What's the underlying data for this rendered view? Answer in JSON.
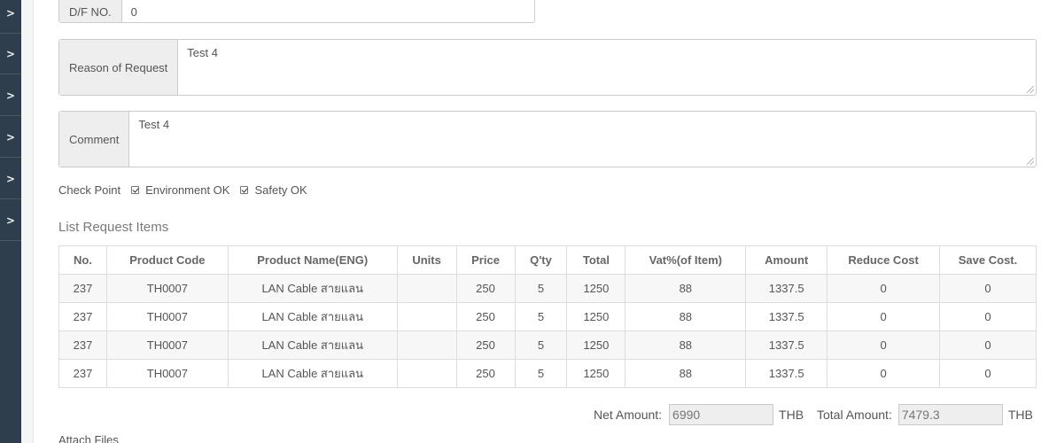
{
  "sidebar": {
    "items": [
      ">",
      ">",
      ">",
      ">",
      ">",
      ">"
    ]
  },
  "form": {
    "df_no": {
      "label": "D/F NO.",
      "value": "0"
    },
    "reason": {
      "label": "Reason of Request",
      "value": "Test 4"
    },
    "comment": {
      "label": "Comment",
      "value": "Test 4"
    },
    "checkpoint": {
      "label": "Check Point",
      "options": [
        {
          "label": "Environment OK",
          "checked": true
        },
        {
          "label": "Safety OK",
          "checked": true
        }
      ]
    }
  },
  "list": {
    "title": "List Request Items",
    "columns": [
      "No.",
      "Product Code",
      "Product Name(ENG)",
      "Units",
      "Price",
      "Q'ty",
      "Total",
      "Vat%(of Item)",
      "Amount",
      "Reduce Cost",
      "Save Cost."
    ],
    "rows": [
      [
        "237",
        "TH0007",
        "LAN Cable สายแลน",
        "",
        "250",
        "5",
        "1250",
        "88",
        "1337.5",
        "0",
        "0"
      ],
      [
        "237",
        "TH0007",
        "LAN Cable สายแลน",
        "",
        "250",
        "5",
        "1250",
        "88",
        "1337.5",
        "0",
        "0"
      ],
      [
        "237",
        "TH0007",
        "LAN Cable สายแลน",
        "",
        "250",
        "5",
        "1250",
        "88",
        "1337.5",
        "0",
        "0"
      ],
      [
        "237",
        "TH0007",
        "LAN Cable สายแลน",
        "",
        "250",
        "5",
        "1250",
        "88",
        "1337.5",
        "0",
        "0"
      ]
    ]
  },
  "totals": {
    "net_label": "Net Amount:",
    "net_value": "6990",
    "net_currency": "THB",
    "total_label": "Total Amount:",
    "total_value": "7479.3",
    "total_currency": "THB"
  },
  "attach": {
    "label": "Attach Files"
  }
}
